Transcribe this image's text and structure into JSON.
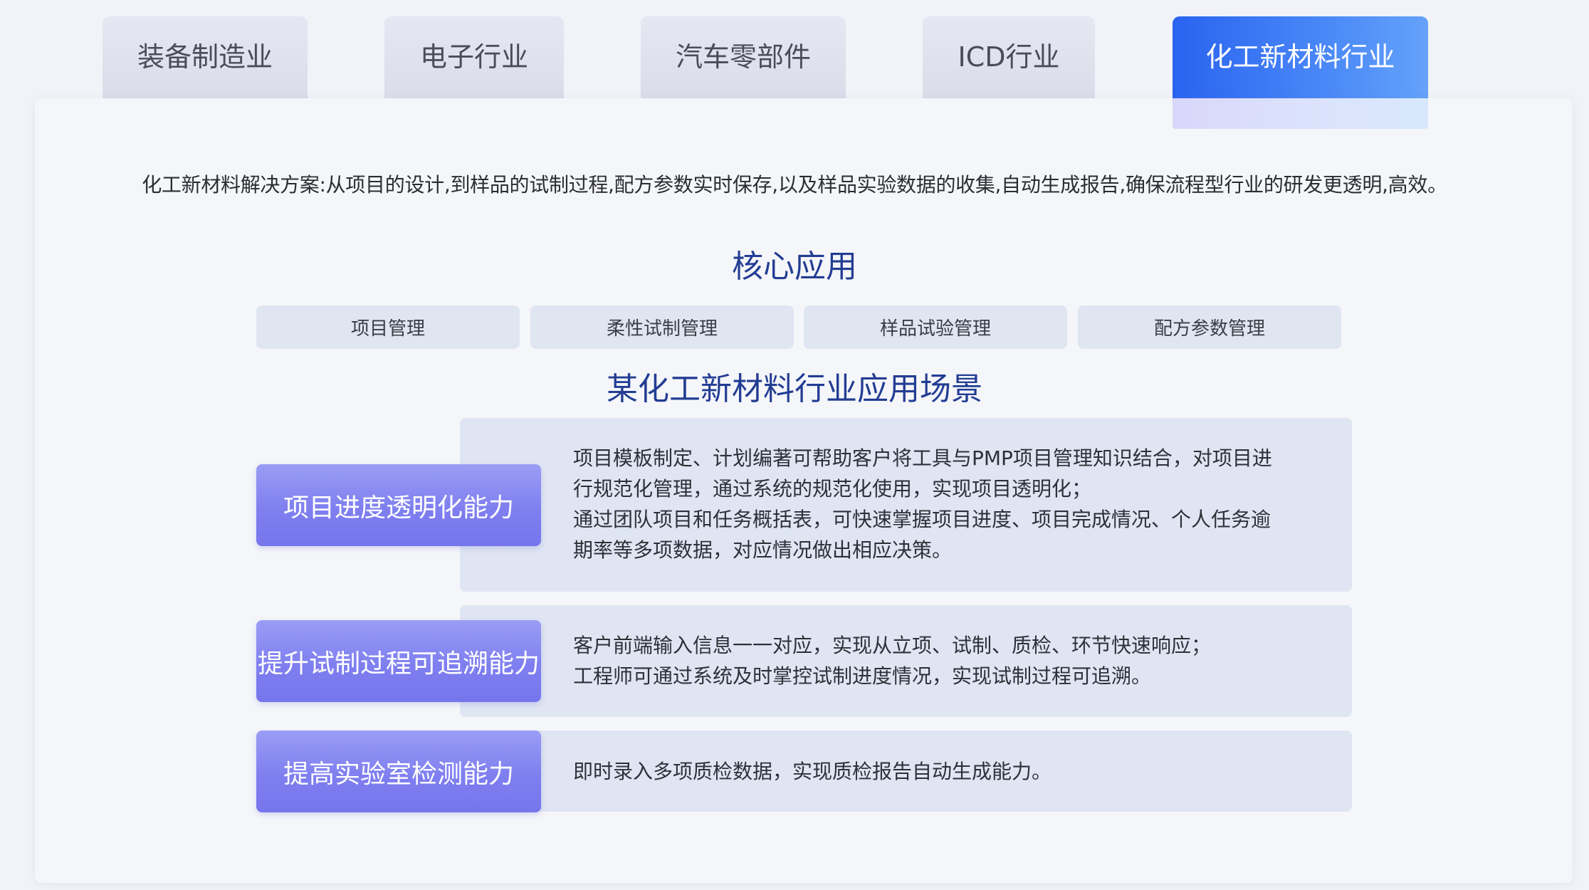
{
  "tabs": [
    {
      "label": "装备制造业",
      "active": false
    },
    {
      "label": "电子行业",
      "active": false
    },
    {
      "label": "汽车零部件",
      "active": false
    },
    {
      "label": "ICD行业",
      "active": false
    },
    {
      "label": "化工新材料行业",
      "active": true
    }
  ],
  "intro_text": "化工新材料解决方案:从项目的设计,到样品的试制过程,配方参数实时保存,以及样品实验数据的收集,自动生成报告,确保流程型行业的研发更透明,高效。",
  "core": {
    "title": "核心应用",
    "items": [
      "项目管理",
      "柔性试制管理",
      "样品试验管理",
      "配方参数管理"
    ]
  },
  "scenario": {
    "title": "某化工新材料行业应用场景",
    "rows": [
      {
        "capability": "项目进度透明化能力",
        "lines": [
          "项目模板制定、计划编著可帮助客户将工具与PMP项目管理知识结合，对项目进",
          "行规范化管理，通过系统的规范化使用，实现项目透明化；",
          "通过团队项目和任务概括表，可快速掌握项目进度、项目完成情况、个人任务逾",
          "期率等多项数据，对应情况做出相应决策。"
        ]
      },
      {
        "capability": "提升试制过程可追溯能力",
        "lines": [
          "客户前端输入信息一一对应，实现从立项、试制、质检、环节快速响应；",
          "工程师可通过系统及时掌控试制进度情况，实现试制过程可追溯。"
        ]
      },
      {
        "capability": "提高实验室检测能力",
        "lines": [
          "即时录入多项质检数据，实现质检报告自动生成能力。"
        ]
      }
    ]
  },
  "colors": {
    "active_tab": "#2a63f0",
    "title": "#233d93",
    "capability": "#7f7ff0",
    "desc_bg": "#dfe5f2"
  }
}
